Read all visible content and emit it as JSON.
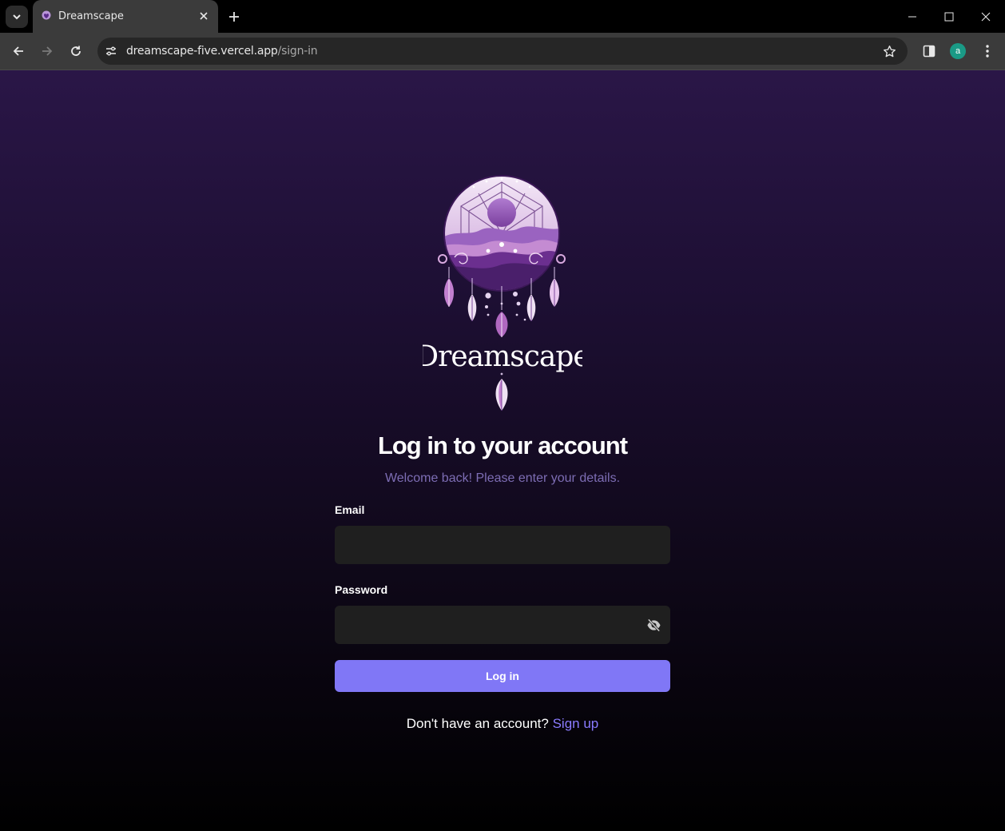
{
  "browser": {
    "tab": {
      "title": "Dreamscape"
    },
    "address": {
      "host": "dreamscape-five.vercel.app",
      "path": "/sign-in"
    },
    "profile_initial": "a"
  },
  "colors": {
    "accent": "#8077f6",
    "link": "#8a7bff",
    "subtitle": "#7d6db4",
    "input_bg": "#1f1f1f",
    "bg_top": "#2a1647",
    "bg_bottom": "#000000"
  },
  "logo": {
    "wordmark": "Dreamscape"
  },
  "form": {
    "heading": "Log in to your account",
    "subheading": "Welcome back! Please enter your details.",
    "email_label": "Email",
    "email_value": "",
    "password_label": "Password",
    "password_value": "",
    "submit_label": "Log in",
    "signup_prompt": "Don't have an account?",
    "signup_link": "Sign up"
  },
  "icons": {
    "password_toggle": "eye-off-icon",
    "favicon": "dreamcatcher-icon"
  }
}
